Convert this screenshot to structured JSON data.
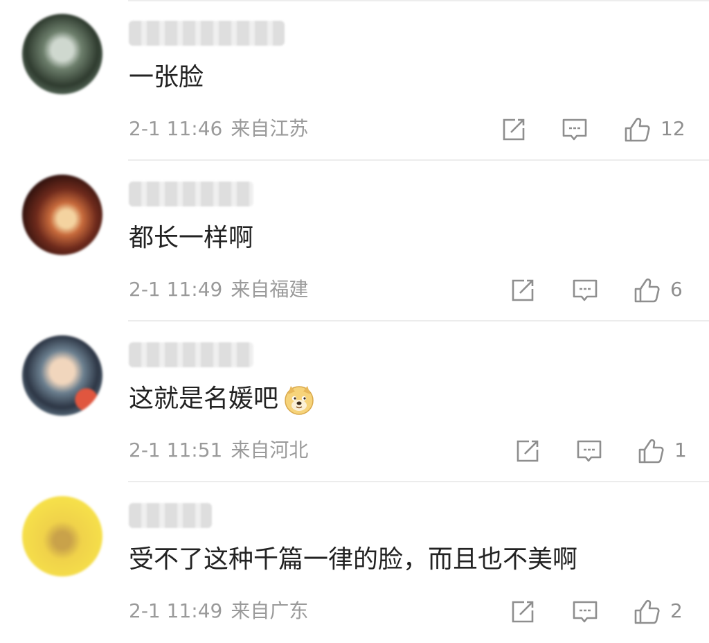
{
  "comments": [
    {
      "text": "一张脸",
      "time": "2-1 11:46",
      "location": "来自江苏",
      "likes": "12",
      "avatar_colors": [
        "#3c4b3b",
        "#9fb3a5"
      ]
    },
    {
      "text": "都长一样啊",
      "time": "2-1 11:49",
      "location": "来自福建",
      "likes": "6",
      "avatar_colors": [
        "#3a1612",
        "#c86b3c"
      ]
    },
    {
      "text": "这就是名媛吧",
      "time": "2-1 11:51",
      "location": "来自河北",
      "likes": "1",
      "avatar_colors": [
        "#2e3a4a",
        "#d9b08c"
      ]
    },
    {
      "text": "受不了这种千篇一律的脸，而且也不美啊",
      "time": "2-1 11:49",
      "location": "来自广东",
      "likes": "2",
      "avatar_colors": [
        "#f2d531",
        "#c9a24a"
      ]
    }
  ],
  "icons": {
    "repost": "repost-icon",
    "comment": "comment-icon",
    "like": "thumbs-up-icon",
    "emoji": "doge-emoji-icon"
  },
  "colors": {
    "text": "#222222",
    "meta": "#9a9a9a",
    "divider": "#ececec"
  }
}
